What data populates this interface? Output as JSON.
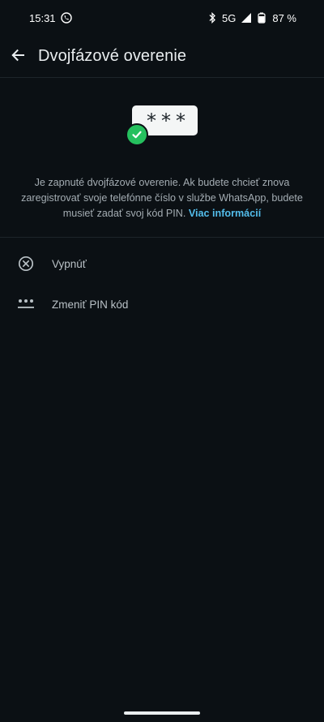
{
  "status_bar": {
    "time": "15:31",
    "network": "5G",
    "battery": "87 %",
    "icons": [
      "whatsapp-call-icon",
      "bluetooth-icon",
      "signal-icon",
      "battery-icon"
    ]
  },
  "app_bar": {
    "title": "Dvojfázové overenie",
    "back_icon": "arrow-left-icon"
  },
  "illustration": {
    "pin_mask": "***",
    "badge_icon": "check-circle-icon",
    "badge_color": "#25c05e"
  },
  "description": {
    "text": "Je zapnuté dvojfázové overenie. Ak budete chcieť znova zaregistrovať svoje telefónne číslo v službe WhatsApp, budete musieť zadať svoj kód PIN.",
    "link": "Viac informácií",
    "link_color": "#53bdeb"
  },
  "options": [
    {
      "label": "Vypnúť",
      "icon": "circle-x-icon"
    },
    {
      "label": "Zmeniť PIN kód",
      "icon": "pin-dots-icon"
    }
  ],
  "colors": {
    "background": "#0b1014",
    "text_primary": "#e9edef",
    "text_secondary": "#a4adb3"
  }
}
